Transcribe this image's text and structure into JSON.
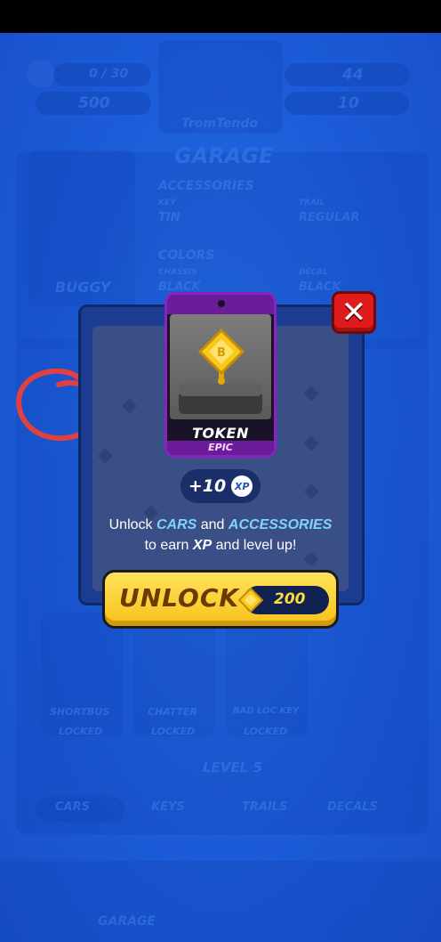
{
  "background": {
    "xp_progress": "0 / 30",
    "coins": "500",
    "gems": "44",
    "tickets": "10",
    "player_name": "TromTendo",
    "garage_title": "GARAGE",
    "car_name": "BUGGY",
    "accessories_title": "ACCESSORIES",
    "key_label": "KEY",
    "key_value": "TIN",
    "trail_label": "TRAIL",
    "trail_value": "REGULAR",
    "colors_title": "COLORS",
    "chassis_label": "CHASSIS",
    "chassis_value": "BLACK",
    "decal_label": "DECAL",
    "decal_value": "BLACK",
    "cars": [
      {
        "name": "SHORTBUS",
        "status": "LOCKED"
      },
      {
        "name": "CHATTER",
        "status": "LOCKED"
      },
      {
        "name": "BAD LOC KEY",
        "status": "LOCKED"
      }
    ],
    "level_label": "LEVEL 5",
    "filters": [
      "CARS",
      "KEYS",
      "TRAILS",
      "DECALS"
    ],
    "nav_label": "GARAGE"
  },
  "card": {
    "name": "TOKEN",
    "rarity": "EPIC"
  },
  "xp": {
    "amount": "+10",
    "badge": "XP"
  },
  "description": {
    "part1": "Unlock ",
    "cars": "CARS",
    "and": " and ",
    "accessories": "ACCESSORIES",
    "line2_pre": "to earn ",
    "xp": "XP",
    "line2_post": " and level up!"
  },
  "unlock_button": {
    "label": "UNLOCK",
    "price": "200"
  },
  "close_button": {
    "icon": "close-icon"
  },
  "colors": {
    "background": "#1f63de",
    "close": "#e01b1b",
    "unlock": "#f7c21b",
    "epic": "#8a22c2",
    "highlight": "#7fd3ff"
  }
}
